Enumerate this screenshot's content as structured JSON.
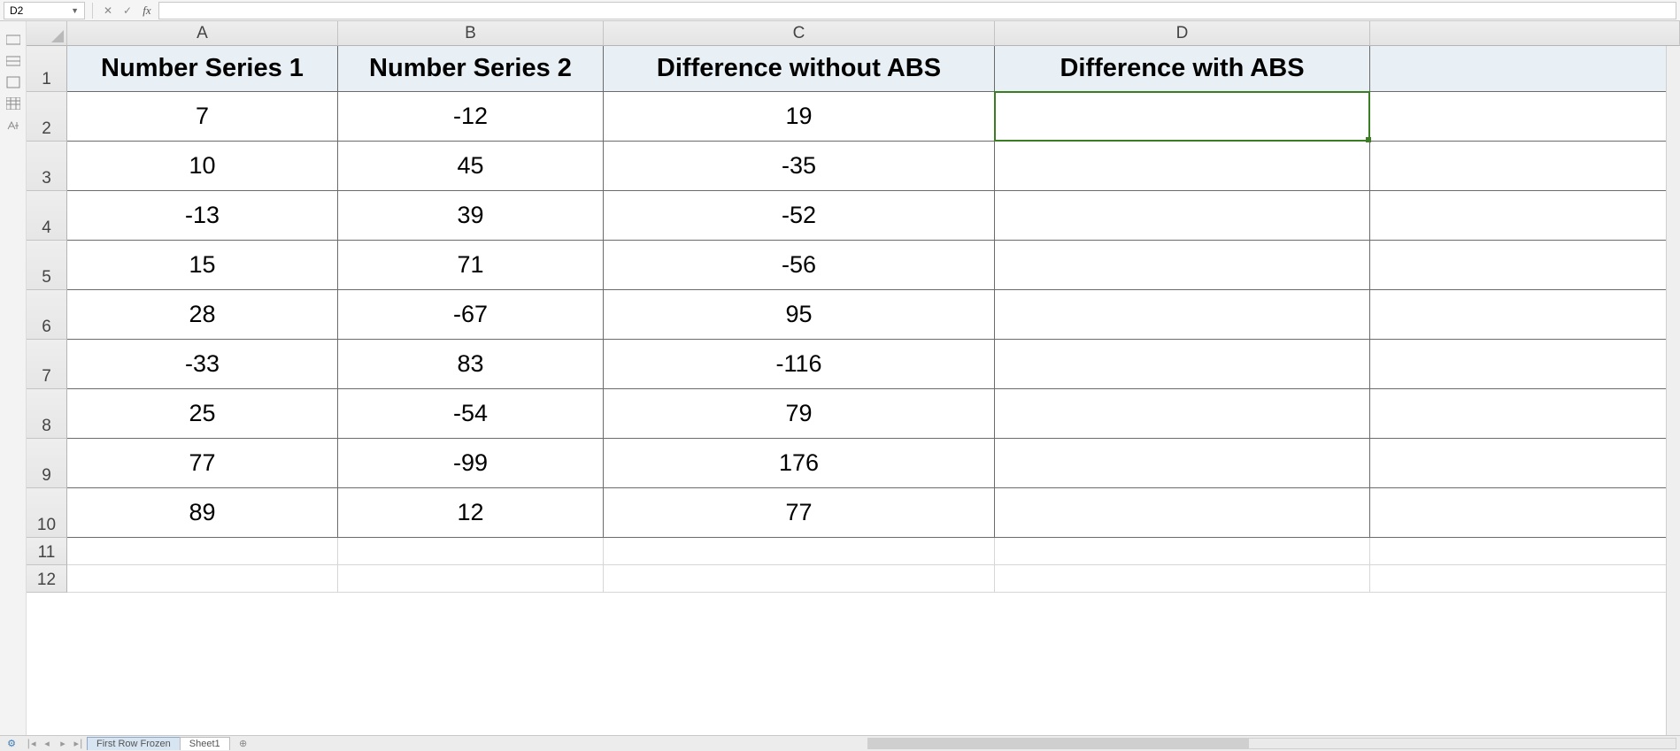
{
  "name_box": "D2",
  "formula_value": "",
  "columns": [
    {
      "letter": "A",
      "cls": "cA"
    },
    {
      "letter": "B",
      "cls": "cB"
    },
    {
      "letter": "C",
      "cls": "cC"
    },
    {
      "letter": "D",
      "cls": "cD"
    }
  ],
  "headers": {
    "A": "Number Series 1",
    "B": "Number Series 2",
    "C": "Difference without ABS",
    "D": "Difference with ABS"
  },
  "data_rows": [
    {
      "A": "7",
      "B": "-12",
      "C": "19",
      "D": ""
    },
    {
      "A": "10",
      "B": "45",
      "C": "-35",
      "D": ""
    },
    {
      "A": "-13",
      "B": "39",
      "C": "-52",
      "D": ""
    },
    {
      "A": "15",
      "B": "71",
      "C": "-56",
      "D": ""
    },
    {
      "A": "28",
      "B": "-67",
      "C": "95",
      "D": ""
    },
    {
      "A": "-33",
      "B": "83",
      "C": "-116",
      "D": ""
    },
    {
      "A": "25",
      "B": "-54",
      "C": "79",
      "D": ""
    },
    {
      "A": "77",
      "B": "-99",
      "C": "176",
      "D": ""
    },
    {
      "A": "89",
      "B": "12",
      "C": "77",
      "D": ""
    }
  ],
  "empty_rows_after": [
    11,
    12
  ],
  "row_heights": {
    "header": 52,
    "data": 56,
    "empty": 31
  },
  "active_cell": {
    "row": 2,
    "col": "D"
  },
  "tabs": [
    {
      "label": "First Row Frozen",
      "active": true
    },
    {
      "label": "Sheet1",
      "active": false
    }
  ]
}
